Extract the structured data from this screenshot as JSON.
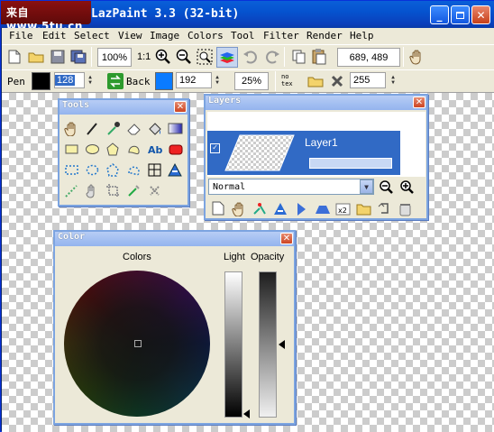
{
  "window": {
    "logo": "来自 www.5tu.cn",
    "title": "LazPaint 3.3 (32-bit)"
  },
  "menu": [
    "File",
    "Edit",
    "Select",
    "View",
    "Image",
    "Colors",
    "Tool",
    "Filter",
    "Render",
    "Help"
  ],
  "toolbar": {
    "zoom_value": "100%",
    "zoom_ratio": "1:1",
    "cursor_coords": "689, 489"
  },
  "pen_bar": {
    "pen_label": "Pen",
    "pen_color": "#000000",
    "pen_alpha": "128",
    "back_label": "Back",
    "back_color": "#0a7bff",
    "back_alpha": "192",
    "tolerance": "25%",
    "no_tex_label": "no\ntex",
    "texture_alpha": "255"
  },
  "tools_window": {
    "title": "Tools",
    "icons": [
      "hand-icon",
      "pen-icon",
      "color-picker-icon",
      "eraser-icon",
      "fill-icon",
      "gradient-icon",
      "rectangle-icon",
      "ellipse-icon",
      "polygon-icon",
      "spline-icon",
      "text-icon",
      "rounded-rect-icon",
      "select-rect-icon",
      "select-ellipse-icon",
      "select-poly-icon",
      "select-spline-icon",
      "select-pen-icon",
      "magic-wand-icon",
      "move-selection-icon",
      "rotate-selection-icon",
      "crop-icon",
      "copy-selection-icon",
      "delete-selection-icon"
    ]
  },
  "layers_window": {
    "title": "Layers",
    "layer_name": "Layer1",
    "layer_visible": true,
    "layer_opacity": 1.0,
    "blend_mode": "Normal",
    "bottom_icons": [
      "new-layer-icon",
      "hand-icon",
      "merge-icon",
      "duplicate-icon",
      "flip-h-icon",
      "flip-v-icon",
      "x2-icon",
      "open-icon",
      "rotate-icon",
      "trash-icon"
    ],
    "x2_label": "x2"
  },
  "color_window": {
    "title": "Color",
    "colors_label": "Colors",
    "light_label": "Light",
    "opacity_label": "Opacity",
    "light_level": 0.0,
    "opacity_level": 0.5
  }
}
